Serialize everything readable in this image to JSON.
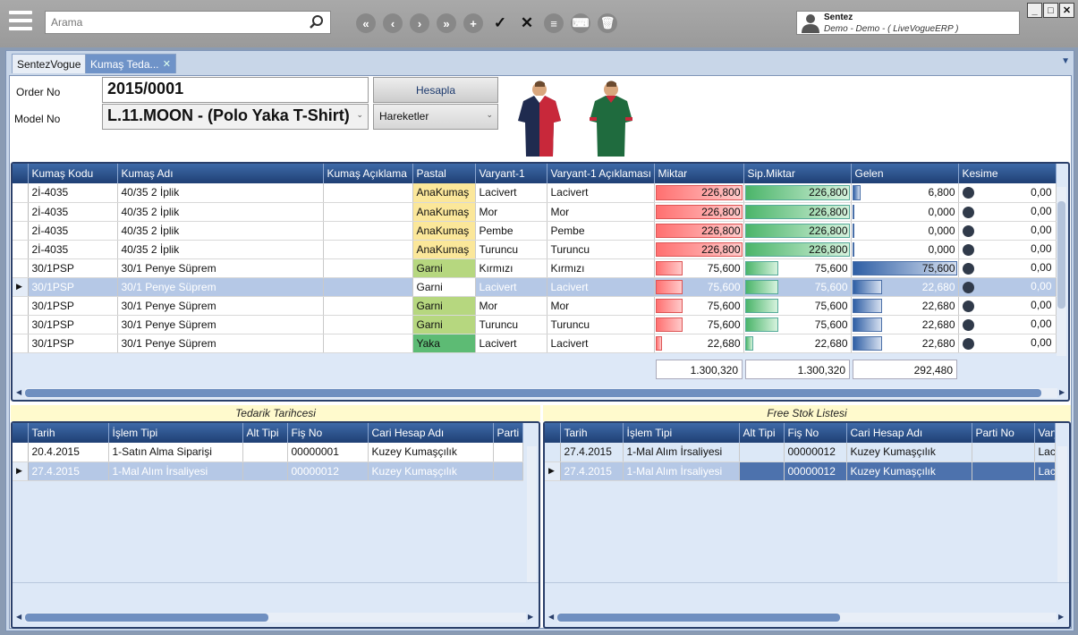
{
  "toolbar": {
    "search_placeholder": "Arama",
    "nav_icons": [
      "first-icon",
      "prev-icon",
      "next-icon",
      "last-icon",
      "add-icon",
      "check-icon",
      "cancel-icon",
      "list-icon",
      "keyboard-icon",
      "delete-icon"
    ]
  },
  "user": {
    "name": "Sentez",
    "subtitle": "Demo - Demo - ( LiveVogueERP )"
  },
  "tabs": [
    {
      "label": "SentezVogue"
    },
    {
      "label": "Kumaş Teda..."
    }
  ],
  "form": {
    "order_label": "Order No",
    "order_value": "2015/0001",
    "model_label": "Model No",
    "model_value": "L.11.MOON - (Polo Yaka T-Shirt)",
    "hesapla_label": "Hesapla",
    "hareketler_label": "Hareketler"
  },
  "colors": {
    "shirt1": "#1f2b4f",
    "shirt1_accent": "#c8283a",
    "shirt2": "#1f6b3e",
    "shirt2_accent": "#c8283a",
    "anakumas": "#fbe79a",
    "garni": "#b6d77f",
    "yaka": "#5dbb74"
  },
  "main_grid": {
    "columns": [
      "Kumaş Kodu",
      "Kumaş Adı",
      "Kumaş Açıklama",
      "Pastal",
      "Varyant-1",
      "Varyant-1 Açıklaması",
      "Miktar",
      "Sip.Miktar",
      "Gelen",
      "Kesime"
    ],
    "rows": [
      {
        "kod": "2İ-4035",
        "ad": "40/35 2 İplik",
        "acik": "",
        "pastal": "AnaKumaş",
        "v1": "Lacivert",
        "v1a": "Lacivert",
        "miktar": "226,800",
        "m_pct": 1,
        "sip": "226,800",
        "s_pct": 1,
        "gelen": "6,800",
        "g_pct": 0.1,
        "kesime": "0,00"
      },
      {
        "kod": "2İ-4035",
        "ad": "40/35 2 İplik",
        "acik": "",
        "pastal": "AnaKumaş",
        "v1": "Mor",
        "v1a": "Mor",
        "miktar": "226,800",
        "m_pct": 1,
        "sip": "226,800",
        "s_pct": 1,
        "gelen": "0,000",
        "g_pct": 0,
        "kesime": "0,00"
      },
      {
        "kod": "2İ-4035",
        "ad": "40/35 2 İplik",
        "acik": "",
        "pastal": "AnaKumaş",
        "v1": "Pembe",
        "v1a": "Pembe",
        "miktar": "226,800",
        "m_pct": 1,
        "sip": "226,800",
        "s_pct": 1,
        "gelen": "0,000",
        "g_pct": 0,
        "kesime": "0,00"
      },
      {
        "kod": "2İ-4035",
        "ad": "40/35 2 İplik",
        "acik": "",
        "pastal": "AnaKumaş",
        "v1": "Turuncu",
        "v1a": "Turuncu",
        "miktar": "226,800",
        "m_pct": 1,
        "sip": "226,800",
        "s_pct": 1,
        "gelen": "0,000",
        "g_pct": 0,
        "kesime": "0,00"
      },
      {
        "kod": "30/1PSP",
        "ad": "30/1 Penye Süprem",
        "acik": "",
        "pastal": "Garni",
        "v1": "Kırmızı",
        "v1a": "Kırmızı",
        "miktar": "75,600",
        "m_pct": 0.33,
        "sip": "75,600",
        "s_pct": 0.33,
        "gelen": "75,600",
        "g_pct": 1,
        "kesime": "0,00"
      },
      {
        "kod": "30/1PSP",
        "ad": "30/1 Penye Süprem",
        "acik": "",
        "pastal": "Garni",
        "v1": "Lacivert",
        "v1a": "Lacivert",
        "miktar": "75,600",
        "m_pct": 0.33,
        "sip": "75,600",
        "s_pct": 0.33,
        "gelen": "22,680",
        "g_pct": 0.3,
        "kesime": "0,00"
      },
      {
        "kod": "30/1PSP",
        "ad": "30/1 Penye Süprem",
        "acik": "",
        "pastal": "Garni",
        "v1": "Mor",
        "v1a": "Mor",
        "miktar": "75,600",
        "m_pct": 0.33,
        "sip": "75,600",
        "s_pct": 0.33,
        "gelen": "22,680",
        "g_pct": 0.3,
        "kesime": "0,00"
      },
      {
        "kod": "30/1PSP",
        "ad": "30/1 Penye Süprem",
        "acik": "",
        "pastal": "Garni",
        "v1": "Turuncu",
        "v1a": "Turuncu",
        "miktar": "75,600",
        "m_pct": 0.33,
        "sip": "75,600",
        "s_pct": 0.33,
        "gelen": "22,680",
        "g_pct": 0.3,
        "kesime": "0,00"
      },
      {
        "kod": "30/1PSP",
        "ad": "30/1 Penye Süprem",
        "acik": "",
        "pastal": "Yaka",
        "v1": "Lacivert",
        "v1a": "Lacivert",
        "miktar": "22,680",
        "m_pct": 0.1,
        "sip": "22,680",
        "s_pct": 0.1,
        "gelen": "22,680",
        "g_pct": 0.3,
        "kesime": "0,00"
      }
    ],
    "current_row": 5,
    "totals": {
      "miktar": "1.300,320",
      "sip": "1.300,320",
      "gelen": "292,480"
    }
  },
  "tedarik": {
    "caption": "Tedarik Tarihcesi",
    "columns": [
      "Tarih",
      "İşlem Tipi",
      "Alt Tipi",
      "Fiş No",
      "Cari Hesap Adı",
      "Parti N"
    ],
    "rows": [
      {
        "tarih": "20.4.2015",
        "islem": "1-Satın Alma Siparişi",
        "alt": "",
        "fis": "00000001",
        "cari": "Kuzey Kumaşçılık",
        "parti": ""
      },
      {
        "tarih": "27.4.2015",
        "islem": "1-Mal Alım İrsaliyesi",
        "alt": "",
        "fis": "00000012",
        "cari": "Kuzey Kumaşçılık",
        "parti": ""
      }
    ],
    "current_row": 1
  },
  "freestok": {
    "caption": "Free Stok Listesi",
    "columns": [
      "Tarih",
      "İşlem Tipi",
      "Alt Tipi",
      "Fiş No",
      "Cari Hesap Adı",
      "Parti No",
      "Vary"
    ],
    "rows": [
      {
        "tarih": "27.4.2015",
        "islem": "1-Mal Alım İrsaliyesi",
        "alt": "",
        "fis": "00000012",
        "cari": "Kuzey Kumaşçılık",
        "parti": "",
        "vary": "Laci"
      },
      {
        "tarih": "27.4.2015",
        "islem": "1-Mal Alım İrsaliyesi",
        "alt": "",
        "fis": "00000012",
        "cari": "Kuzey Kumaşçılık",
        "parti": "",
        "vary": "Laci"
      }
    ],
    "current_row": 1
  }
}
